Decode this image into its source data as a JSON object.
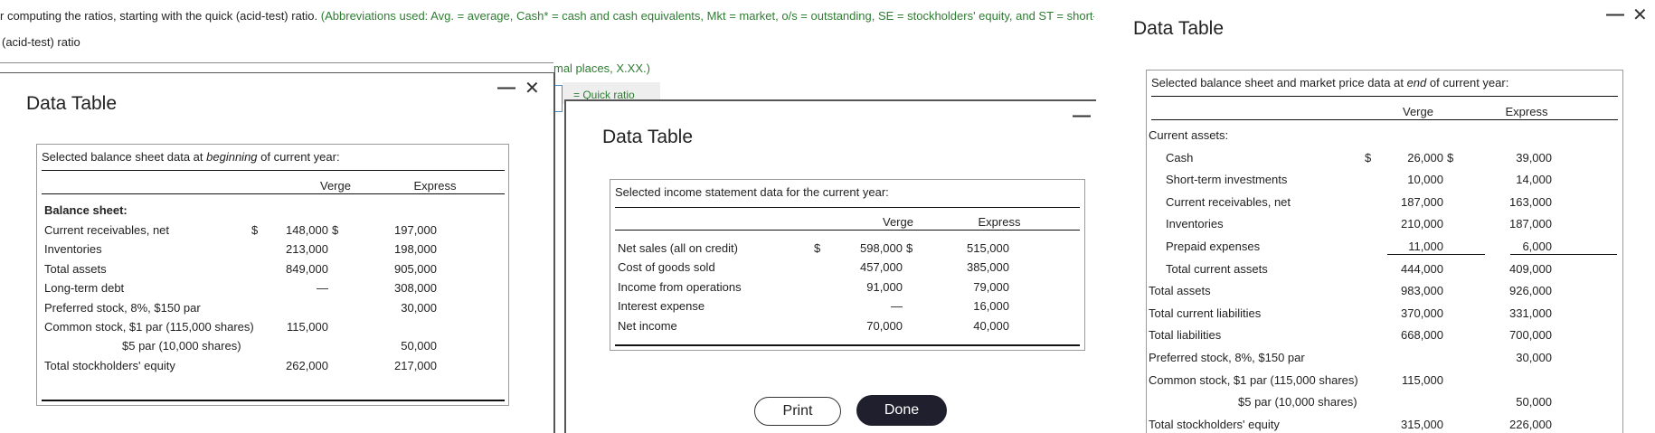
{
  "question": {
    "line1_prefix": "r computing the ratios, starting with the quick (acid-test) ratio.",
    "line1_green": "(Abbreviations used: Avg. = average, Cash* = cash and cash equivalents, Mkt = market, o/s = outstanding, SE = stockholders' equity, and ST = short-",
    "line2": "(acid-test) ratio",
    "line3": "mal places, X.XX.)",
    "quick_label": "= Quick ratio"
  },
  "dialog_beginning": {
    "title": "Data Table",
    "caption_pre": "Selected balance sheet data at ",
    "caption_em": "beginning",
    "caption_post": " of current year:",
    "col_verge": "Verge",
    "col_express": "Express",
    "section": "Balance sheet:",
    "rows": [
      {
        "label": "Current receivables, net",
        "dollar1": "$",
        "verge": "148,000",
        "dollar2": "$",
        "express": "197,000"
      },
      {
        "label": "Inventories",
        "dollar1": "",
        "verge": "213,000",
        "dollar2": "",
        "express": "198,000"
      },
      {
        "label": "Total assets",
        "dollar1": "",
        "verge": "849,000",
        "dollar2": "",
        "express": "905,000"
      },
      {
        "label": "Long-term debt",
        "dollar1": "",
        "verge": "—",
        "dollar2": "",
        "express": "308,000"
      },
      {
        "label": "Preferred stock, 8%, $150 par",
        "dollar1": "",
        "verge": "",
        "dollar2": "",
        "express": "30,000"
      },
      {
        "label": "Common stock, $1 par (115,000 shares)",
        "dollar1": "",
        "verge": "115,000",
        "dollar2": "",
        "express": ""
      },
      {
        "label": "$5 par (10,000 shares)",
        "dollar1": "",
        "verge": "",
        "dollar2": "",
        "express": "50,000"
      },
      {
        "label": "Total stockholders' equity",
        "dollar1": "",
        "verge": "262,000",
        "dollar2": "",
        "express": "217,000"
      }
    ]
  },
  "dialog_income": {
    "title": "Data Table",
    "caption": "Selected income statement data for the current year:",
    "col_verge": "Verge",
    "col_express": "Express",
    "rows": [
      {
        "label": "Net sales (all on credit)",
        "dollar1": "$",
        "verge": "598,000",
        "dollar2": "$",
        "express": "515,000"
      },
      {
        "label": "Cost of goods sold",
        "dollar1": "",
        "verge": "457,000",
        "dollar2": "",
        "express": "385,000"
      },
      {
        "label": "Income from operations",
        "dollar1": "",
        "verge": "91,000",
        "dollar2": "",
        "express": "79,000"
      },
      {
        "label": "Interest expense",
        "dollar1": "",
        "verge": "—",
        "dollar2": "",
        "express": "16,000"
      },
      {
        "label": "Net income",
        "dollar1": "",
        "verge": "70,000",
        "dollar2": "",
        "express": "40,000"
      }
    ],
    "print_label": "Print",
    "done_label": "Done"
  },
  "dialog_end": {
    "title": "Data Table",
    "caption_pre": "Selected balance sheet and market price data at ",
    "caption_em": "end",
    "caption_post": " of current year:",
    "col_verge": "Verge",
    "col_express": "Express",
    "rows": [
      {
        "label": "Current assets:",
        "dollar1": "",
        "verge": "",
        "dollar2": "",
        "express": ""
      },
      {
        "label": "Cash",
        "dollar1": "$",
        "verge": "26,000",
        "dollar2": "$",
        "express": "39,000"
      },
      {
        "label": "Short-term investments",
        "dollar1": "",
        "verge": "10,000",
        "dollar2": "",
        "express": "14,000"
      },
      {
        "label": "Current receivables, net",
        "dollar1": "",
        "verge": "187,000",
        "dollar2": "",
        "express": "163,000"
      },
      {
        "label": "Inventories",
        "dollar1": "",
        "verge": "210,000",
        "dollar2": "",
        "express": "187,000"
      },
      {
        "label": "Prepaid expenses",
        "dollar1": "",
        "verge": "11,000",
        "dollar2": "",
        "express": "6,000"
      },
      {
        "label": "Total current assets",
        "dollar1": "",
        "verge": "444,000",
        "dollar2": "",
        "express": "409,000"
      },
      {
        "label": "Total assets",
        "dollar1": "",
        "verge": "983,000",
        "dollar2": "",
        "express": "926,000"
      },
      {
        "label": "Total current liabilities",
        "dollar1": "",
        "verge": "370,000",
        "dollar2": "",
        "express": "331,000"
      },
      {
        "label": "Total liabilities",
        "dollar1": "",
        "verge": "668,000",
        "dollar2": "",
        "express": "700,000"
      },
      {
        "label": "Preferred stock, 8%, $150 par",
        "dollar1": "",
        "verge": "",
        "dollar2": "",
        "express": "30,000"
      },
      {
        "label": "Common stock, $1 par (115,000 shares)",
        "dollar1": "",
        "verge": "115,000",
        "dollar2": "",
        "express": ""
      },
      {
        "label": "$5 par (10,000 shares)",
        "dollar1": "",
        "verge": "",
        "dollar2": "",
        "express": "50,000"
      },
      {
        "label": "Total stockholders' equity",
        "dollar1": "",
        "verge": "315,000",
        "dollar2": "",
        "express": "226,000"
      }
    ]
  },
  "icons": {
    "minimize": "—",
    "close": "✕"
  }
}
